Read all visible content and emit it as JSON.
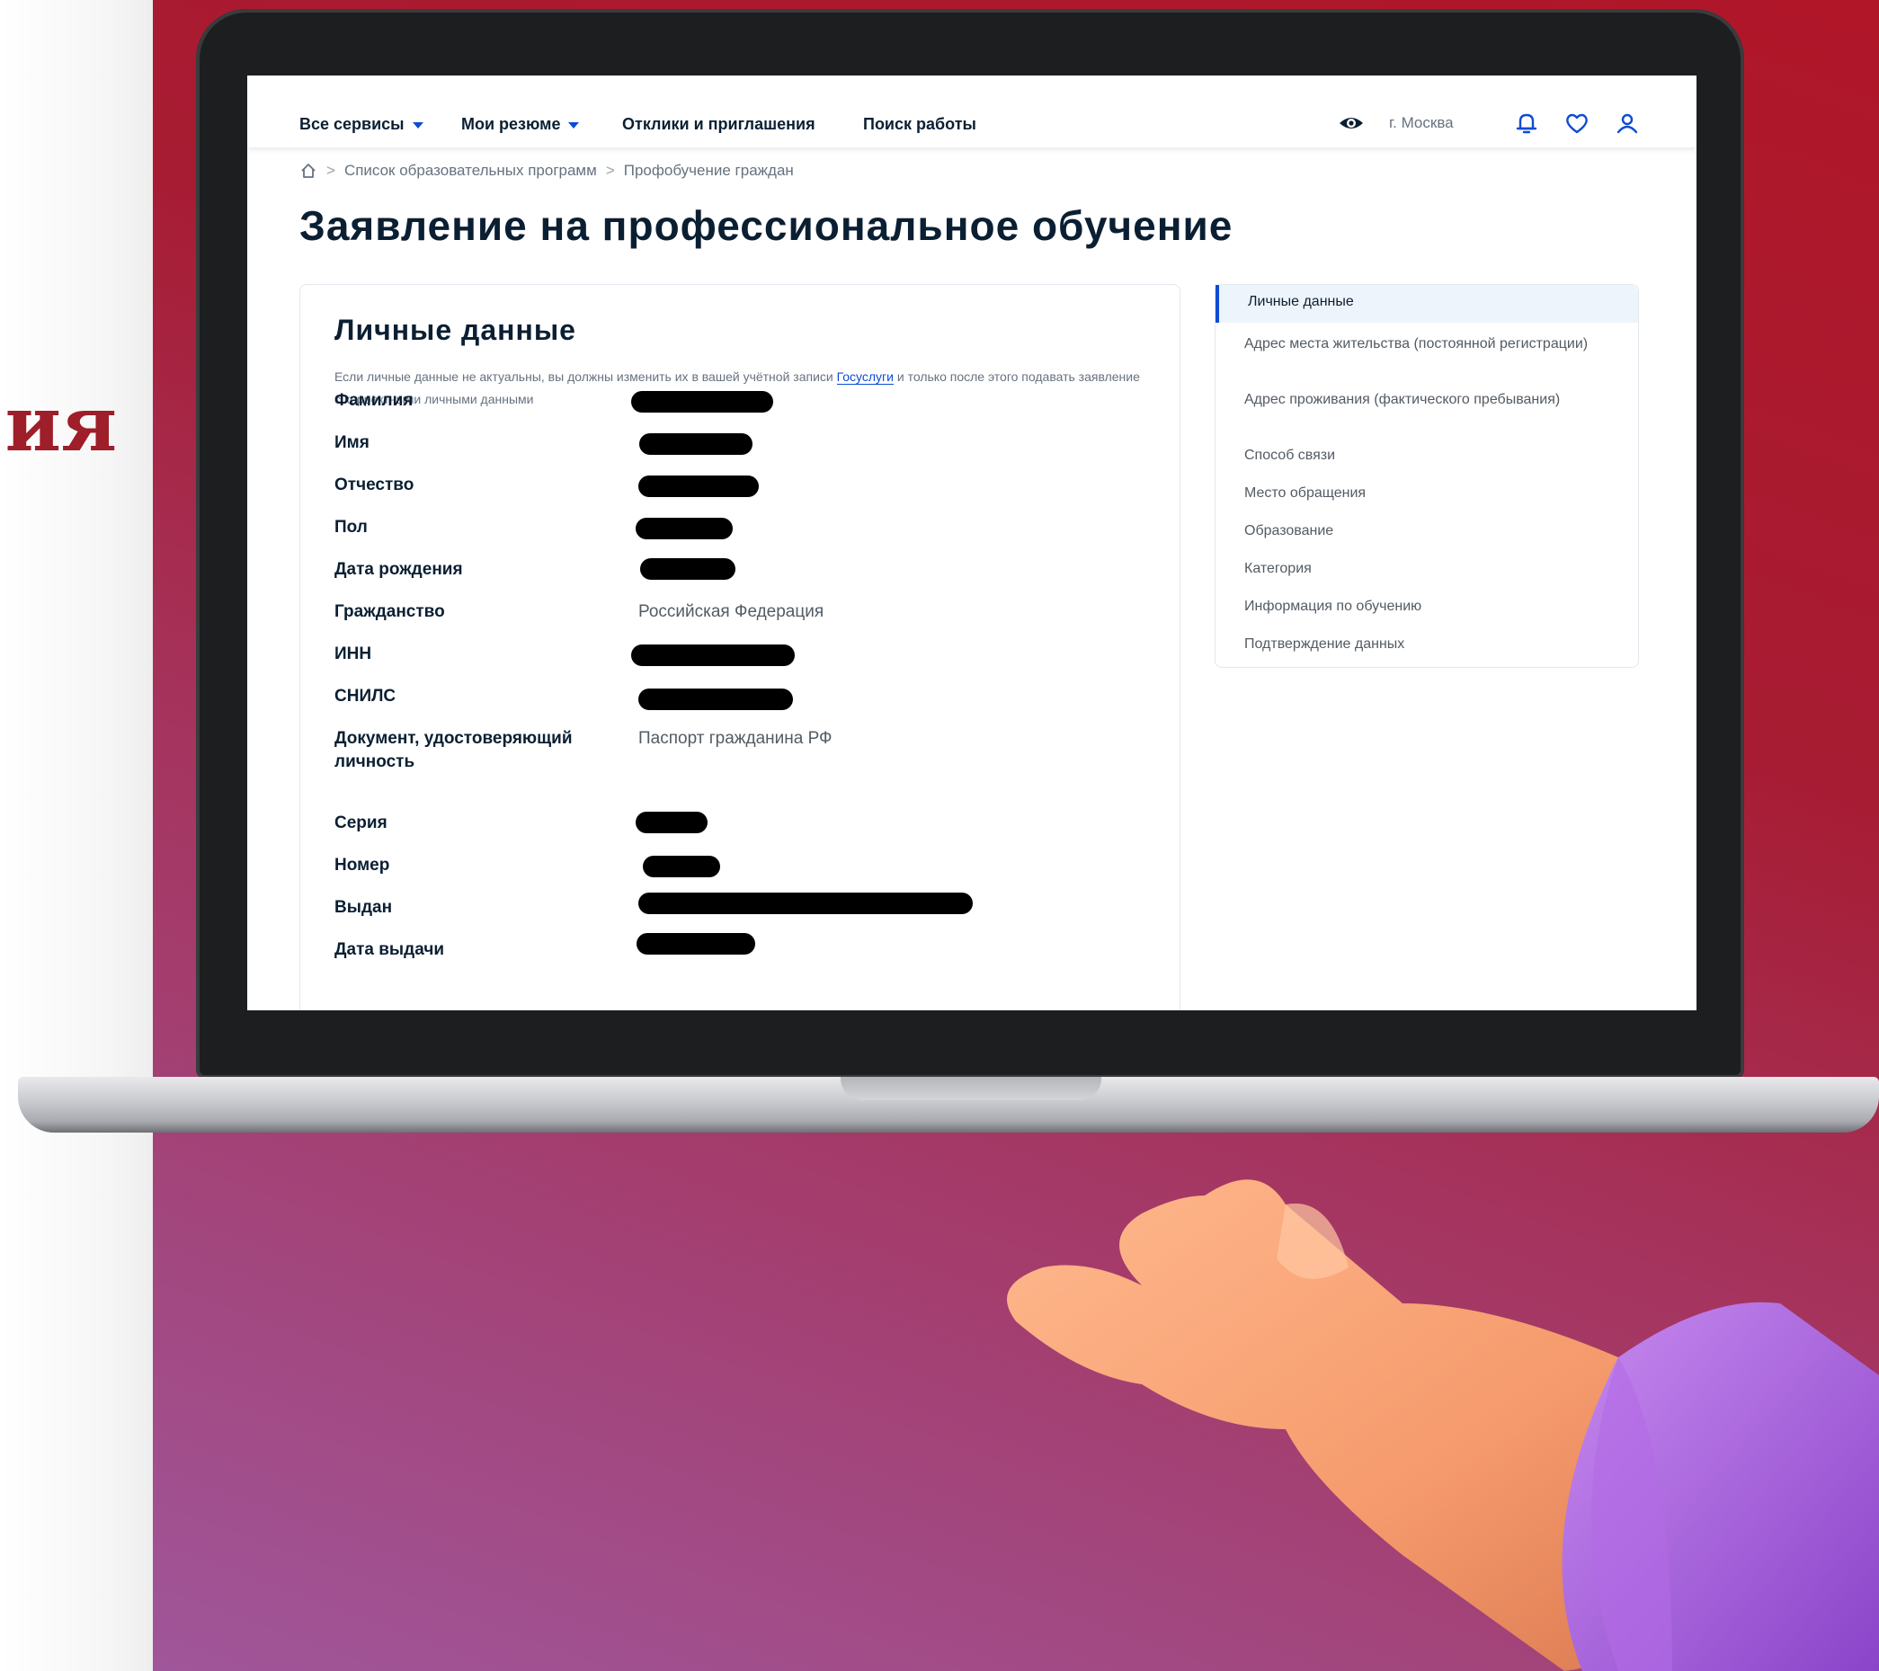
{
  "left_fragment": "ия",
  "nav": {
    "items": [
      {
        "label": "Все сервисы",
        "dropdown": true
      },
      {
        "label": "Мои резюме",
        "dropdown": true
      },
      {
        "label": "Отклики и приглашения",
        "dropdown": false
      },
      {
        "label": "Поиск работы",
        "dropdown": false
      }
    ],
    "city": "г. Москва",
    "icons": [
      "eye-icon",
      "bell-icon",
      "heart-icon",
      "user-icon"
    ]
  },
  "breadcrumb": {
    "separator": ">",
    "items": [
      "Список образовательных программ",
      "Профобучение граждан"
    ]
  },
  "page_title": "Заявление на профессиональное обучение",
  "personal": {
    "title": "Личные данные",
    "note_before": "Если личные данные не актуальны, вы должны изменить их в вашей учётной записи ",
    "note_link": "Госуслуги",
    "note_after": " и только после этого подавать заявление с корректными личными данными",
    "fields": [
      {
        "label": "Фамилия",
        "value": null
      },
      {
        "label": "Имя",
        "value": null
      },
      {
        "label": "Отчество",
        "value": null
      },
      {
        "label": "Пол",
        "value": null
      },
      {
        "label": "Дата рождения",
        "value": null
      },
      {
        "label": "Гражданство",
        "value": "Российская Федерация"
      },
      {
        "label": "ИНН",
        "value": null
      },
      {
        "label": "СНИЛС",
        "value": null
      },
      {
        "label": "Документ, удостоверяющий личность",
        "value": "Паспорт гражданина РФ"
      },
      {
        "label": "Серия",
        "value": null
      },
      {
        "label": "Номер",
        "value": null
      },
      {
        "label": "Выдан",
        "value": null
      },
      {
        "label": "Дата выдачи",
        "value": null
      }
    ]
  },
  "sidebar": {
    "active": "Личные данные",
    "items": [
      "Адрес места жительства (постоянной регистрации)",
      "Адрес проживания (фактического пребывания)",
      "Способ связи",
      "Место обращения",
      "Образование",
      "Категория",
      "Информация по обучению",
      "Подтверждение данных"
    ]
  },
  "colors": {
    "accent": "#0d4cd3",
    "text": "#0b1f33",
    "muted": "#66727f",
    "brand_red": "#9e1e2a"
  }
}
